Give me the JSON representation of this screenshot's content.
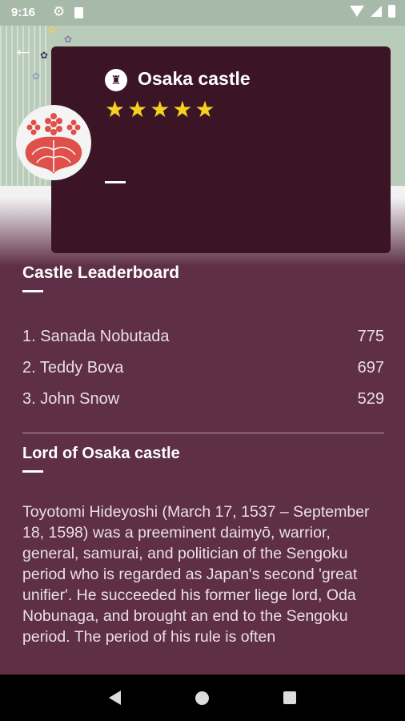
{
  "status_bar": {
    "time": "9:16"
  },
  "castle": {
    "name": "Osaka castle",
    "rating": 5
  },
  "leaderboard": {
    "title": "Castle Leaderboard",
    "entries": [
      {
        "name": "1. Sanada Nobutada",
        "score": "775"
      },
      {
        "name": "2. Teddy Bova",
        "score": "697"
      },
      {
        "name": "3. John Snow",
        "score": "529"
      }
    ]
  },
  "lord": {
    "title": "Lord of Osaka castle",
    "description": "Toyotomi Hideyoshi (March 17, 1537 – September 18, 1598) was a preeminent daimyō, warrior, general, samurai, and politician of the Sengoku period who is regarded as Japan's second 'great unifier'. He succeeded his former liege lord, Oda Nobunaga, and brought an end to the Sengoku period. The period of his rule is often"
  },
  "colors": {
    "background": "#5e2f46",
    "card": "#3b1526",
    "star": "#f4d21f",
    "emblem": "#e0504a"
  }
}
